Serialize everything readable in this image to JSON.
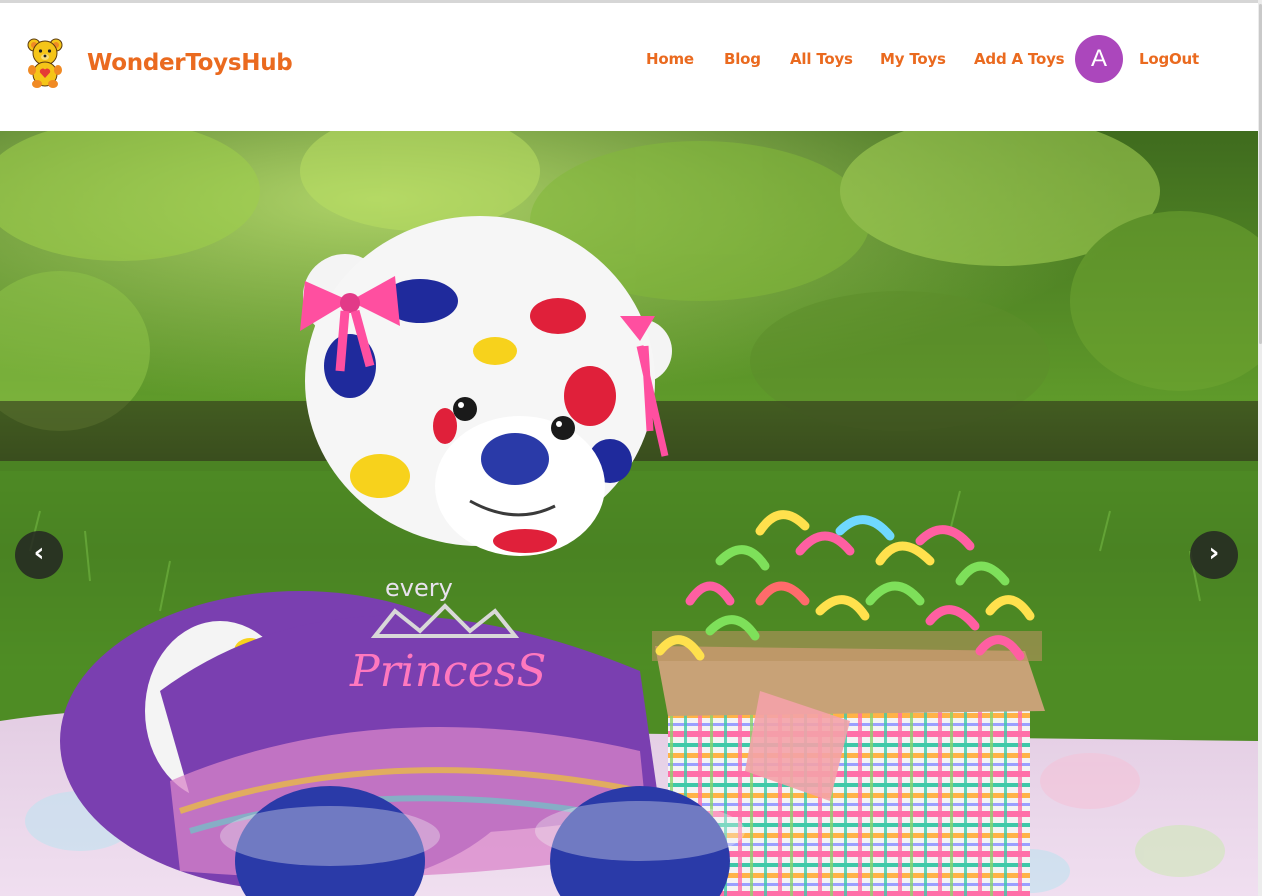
{
  "brand": {
    "name": "WonderToysHub",
    "logo_icon": "teddy-bear-logo-icon"
  },
  "nav": {
    "items": [
      {
        "label": "Home"
      },
      {
        "label": "Blog"
      },
      {
        "label": "All Toys"
      },
      {
        "label": "My Toys"
      },
      {
        "label": "Add A Toys"
      }
    ],
    "avatar_initial": "A",
    "logout_label": "LogOut"
  },
  "hero": {
    "image": "teddy-bear-with-gift-box-photo",
    "shirt_text_line1": "every",
    "shirt_text_line2": "PrincesS",
    "prev_label": "‹",
    "next_label": "›"
  },
  "colors": {
    "accent": "#ea6a1f",
    "avatar_bg": "#ab47bc",
    "arrow_bg": "#222222"
  }
}
